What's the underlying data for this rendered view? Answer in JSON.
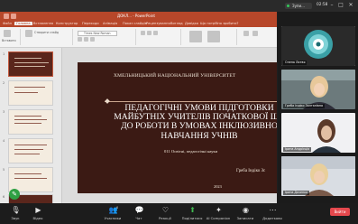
{
  "topbar": {
    "share_text": "Зупи...",
    "time": "02:58",
    "minimize": "–",
    "maximize": "□",
    "close": "✕"
  },
  "powerpoint": {
    "window_title": "ДОКЛ... - PowerPoint",
    "menu_tabs": [
      "Файл",
      "Головна",
      "Вставлення",
      "Конструктор",
      "Переходи",
      "Анімація",
      "Показ слайдів",
      "Рецензування",
      "Вигляд",
      "Довідка",
      "Що потрібно зробити?"
    ],
    "active_tab": "Головна",
    "ribbon": {
      "paste": "Вставити",
      "new_slide": "Створити слайд",
      "font": "Times New Roman"
    },
    "slides": [
      {
        "number": "1",
        "selected": true
      },
      {
        "number": "2",
        "selected": false
      },
      {
        "number": "3",
        "selected": false
      },
      {
        "number": "4",
        "selected": false
      },
      {
        "number": "5",
        "selected": false
      },
      {
        "number": "6",
        "selected": false
      }
    ],
    "current_slide": {
      "university": "ХМЕЛЬНИЦЬКИЙ НАЦІОНАЛЬНИЙ УНІВЕРСИТЕТ",
      "title_lines": [
        "ПЕДАГОГІЧНІ УМОВИ ПІДГОТОВКИ",
        "МАЙБУТНІХ УЧИТЕЛІВ ПОЧАТКОВОЇ ШК",
        "ДО РОБОТИ В УМОВАХ ІНКЛЮЗИВНО",
        "НАВЧАННЯ УЧНІВ"
      ],
      "specialty": "011 Освітні, педагогічні науки",
      "author": "Греба Індіко Зс",
      "year": "2023"
    }
  },
  "participants": [
    {
      "name": "Олена Литвя",
      "tile": "avatar-pattern"
    },
    {
      "name": "Греба Індіко Золтанівна",
      "tile": "video-woman-blonde"
    },
    {
      "name": "Ірина Андрієція",
      "tile": "video-woman-headphones"
    },
    {
      "name": "Ірина Дяченко",
      "tile": "video-woman-blonde-2"
    }
  ],
  "bottom_bar": {
    "mic": "Звук",
    "video": "Відео",
    "participants": "Учасники",
    "participants_count": "6",
    "chat": "Чат",
    "reactions": "Реакції",
    "share": "Поділитися",
    "ai": "AI Companion",
    "record": "Записати",
    "more": "Додатково",
    "end": "Вийти"
  },
  "colors": {
    "powerpoint_accent": "#b7472a",
    "slide_background": "#3b1a14",
    "end_button": "#e5484d"
  }
}
